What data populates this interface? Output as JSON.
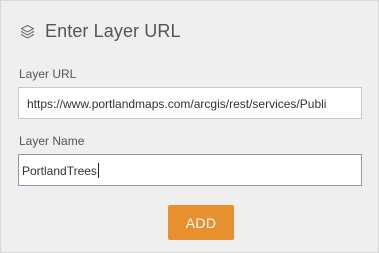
{
  "header": {
    "icon": "layers-icon",
    "title": "Enter Layer URL"
  },
  "layer_url": {
    "label": "Layer URL",
    "value": "https://www.portlandmaps.com/arcgis/rest/services/Publi"
  },
  "layer_name": {
    "label": "Layer Name",
    "value": "PortlandTrees"
  },
  "add_button": {
    "label": "ADD"
  },
  "colors": {
    "panel_background": "#efefef",
    "accent_button": "#e8902e",
    "focused_border": "#8a9ab0"
  }
}
